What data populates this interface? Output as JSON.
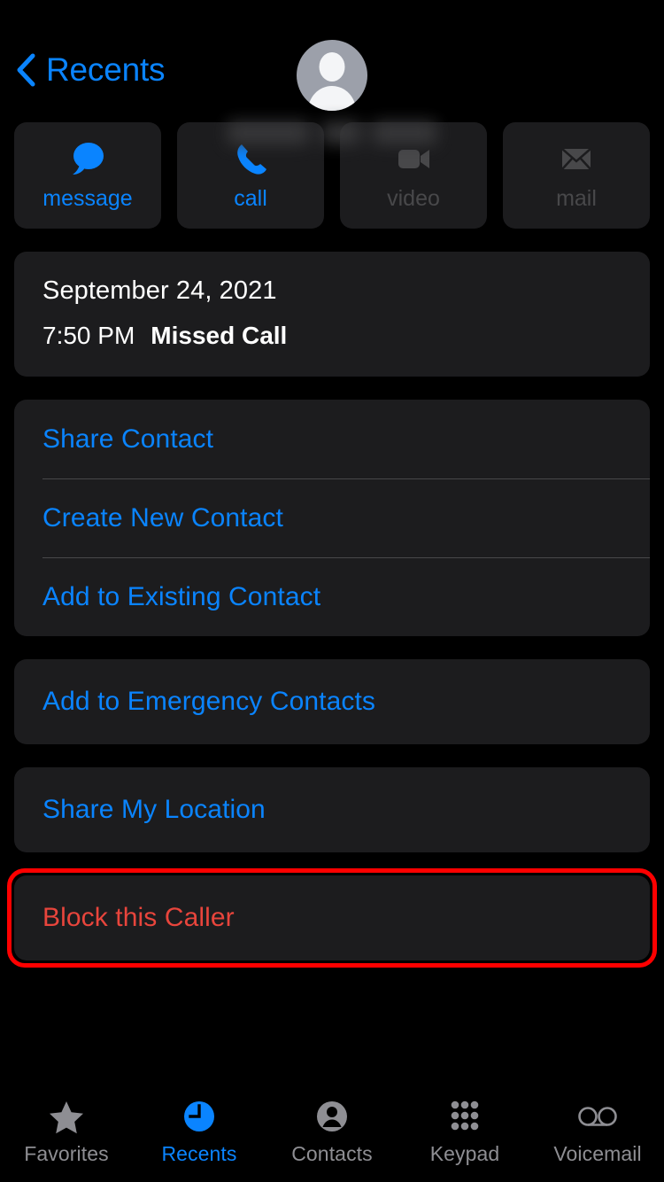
{
  "navbar": {
    "back_label": "Recents",
    "back_icon": "chevron-left-icon",
    "accent_color": "#0A84FF"
  },
  "contact": {
    "avatar_icon": "person-avatar-icon",
    "name_redacted": true,
    "name": ""
  },
  "actions": [
    {
      "label": "message",
      "icon": "message-bubble-icon",
      "enabled": true
    },
    {
      "label": "call",
      "icon": "phone-handset-icon",
      "enabled": true
    },
    {
      "label": "video",
      "icon": "video-camera-icon",
      "enabled": false
    },
    {
      "label": "mail",
      "icon": "envelope-icon",
      "enabled": false
    }
  ],
  "call_info": {
    "date": "September 24, 2021",
    "time": "7:50 PM",
    "status": "Missed Call"
  },
  "contact_menu": [
    {
      "label": "Share Contact"
    },
    {
      "label": "Create New Contact"
    },
    {
      "label": "Add to Existing Contact"
    }
  ],
  "emergency": {
    "label": "Add to Emergency Contacts"
  },
  "location": {
    "label": "Share My Location"
  },
  "block": {
    "label": "Block this Caller",
    "text_color": "#E8453C",
    "highlight_color": "#FF0000"
  },
  "tabbar": {
    "tabs": [
      {
        "label": "Favorites",
        "icon": "star-icon",
        "active": false
      },
      {
        "label": "Recents",
        "icon": "clock-icon",
        "active": true
      },
      {
        "label": "Contacts",
        "icon": "person-circle-icon",
        "active": false
      },
      {
        "label": "Keypad",
        "icon": "keypad-grid-icon",
        "active": false
      },
      {
        "label": "Voicemail",
        "icon": "voicemail-icon",
        "active": false
      }
    ]
  }
}
